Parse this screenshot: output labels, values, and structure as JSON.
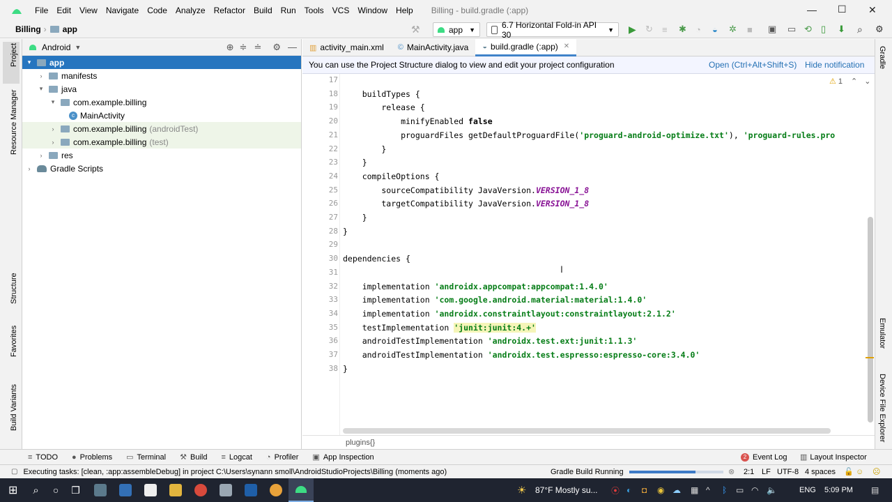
{
  "titlebar": {
    "menu": [
      "File",
      "Edit",
      "View",
      "Navigate",
      "Code",
      "Analyze",
      "Refactor",
      "Build",
      "Run",
      "Tools",
      "VCS",
      "Window",
      "Help"
    ],
    "title": "Billing - build.gradle (:app)"
  },
  "navbar": {
    "project": "Billing",
    "module": "app",
    "run_config": "app",
    "device": "6.7  Horizontal Fold-in API 30"
  },
  "left_strip": [
    "Project",
    "Resource Manager",
    "Structure",
    "Favorites",
    "Build Variants"
  ],
  "right_strip": [
    "Gradle",
    "Emulator",
    "Device File Explorer"
  ],
  "project_panel": {
    "view_mode": "Android",
    "tree": [
      {
        "label": "app",
        "muted": "",
        "depth": 0,
        "arrow": "▾",
        "icon": "folder",
        "selected": true,
        "green": false
      },
      {
        "label": "manifests",
        "muted": "",
        "depth": 1,
        "arrow": "›",
        "icon": "folder",
        "selected": false,
        "green": false
      },
      {
        "label": "java",
        "muted": "",
        "depth": 1,
        "arrow": "▾",
        "icon": "folder",
        "selected": false,
        "green": false
      },
      {
        "label": "com.example.billing",
        "muted": "",
        "depth": 2,
        "arrow": "▾",
        "icon": "folder",
        "selected": false,
        "green": false
      },
      {
        "label": "MainActivity",
        "muted": "",
        "depth": 3,
        "arrow": "",
        "icon": "class",
        "selected": false,
        "green": false
      },
      {
        "label": "com.example.billing",
        "muted": "(androidTest)",
        "depth": 2,
        "arrow": "›",
        "icon": "folder",
        "selected": false,
        "green": true
      },
      {
        "label": "com.example.billing",
        "muted": "(test)",
        "depth": 2,
        "arrow": "›",
        "icon": "folder",
        "selected": false,
        "green": true
      },
      {
        "label": "res",
        "muted": "",
        "depth": 1,
        "arrow": "›",
        "icon": "folder",
        "selected": false,
        "green": false
      },
      {
        "label": "Gradle Scripts",
        "muted": "",
        "depth": 0,
        "arrow": "›",
        "icon": "gradle",
        "selected": false,
        "green": false
      }
    ]
  },
  "tabs": [
    {
      "label": "activity_main.xml",
      "active": false
    },
    {
      "label": "MainActivity.java",
      "active": false
    },
    {
      "label": "build.gradle (:app)",
      "active": true
    }
  ],
  "notice": {
    "text": "You can use the Project Structure dialog to view and edit your project configuration",
    "open_link": "Open (Ctrl+Alt+Shift+S)",
    "hide_link": "Hide notification"
  },
  "editor": {
    "warning_count": "1",
    "lines": [
      {
        "n": "17",
        "parts": []
      },
      {
        "n": "18",
        "parts": [
          [
            "",
            "    buildTypes {"
          ]
        ]
      },
      {
        "n": "19",
        "parts": [
          [
            "",
            "        release {"
          ]
        ]
      },
      {
        "n": "20",
        "parts": [
          [
            "",
            "            minifyEnabled "
          ],
          [
            "kw",
            "false"
          ]
        ]
      },
      {
        "n": "21",
        "parts": [
          [
            "",
            "            proguardFiles getDefaultProguardFile("
          ],
          [
            "str",
            "'proguard-android-optimize.txt'"
          ],
          [
            "",
            "), "
          ],
          [
            "str",
            "'proguard-rules.pro"
          ]
        ]
      },
      {
        "n": "22",
        "parts": [
          [
            "",
            "        }"
          ]
        ]
      },
      {
        "n": "23",
        "parts": [
          [
            "",
            "    }"
          ]
        ]
      },
      {
        "n": "24",
        "parts": [
          [
            "",
            "    compileOptions {"
          ]
        ]
      },
      {
        "n": "25",
        "parts": [
          [
            "",
            "        sourceCompatibility JavaVersion."
          ],
          [
            "it",
            "VERSION_1_8"
          ]
        ]
      },
      {
        "n": "26",
        "parts": [
          [
            "",
            "        targetCompatibility JavaVersion."
          ],
          [
            "it",
            "VERSION_1_8"
          ]
        ]
      },
      {
        "n": "27",
        "parts": [
          [
            "",
            "    }"
          ]
        ]
      },
      {
        "n": "28",
        "parts": [
          [
            "",
            "}"
          ]
        ]
      },
      {
        "n": "29",
        "parts": []
      },
      {
        "n": "30",
        "parts": [
          [
            "",
            "dependencies {"
          ]
        ]
      },
      {
        "n": "31",
        "parts": []
      },
      {
        "n": "32",
        "parts": [
          [
            "",
            "    implementation "
          ],
          [
            "str",
            "'androidx.appcompat:appcompat:1.4.0'"
          ]
        ]
      },
      {
        "n": "33",
        "parts": [
          [
            "",
            "    implementation "
          ],
          [
            "str",
            "'com.google.android.material:material:1.4.0'"
          ]
        ]
      },
      {
        "n": "34",
        "parts": [
          [
            "",
            "    implementation "
          ],
          [
            "str",
            "'androidx.constraintlayout:constraintlayout:2.1.2'"
          ]
        ]
      },
      {
        "n": "35",
        "parts": [
          [
            "",
            "    testImplementation "
          ],
          [
            "str hl",
            "'junit:junit:4.+'"
          ]
        ]
      },
      {
        "n": "36",
        "parts": [
          [
            "",
            "    androidTestImplementation "
          ],
          [
            "str",
            "'androidx.test.ext:junit:1.1.3'"
          ]
        ]
      },
      {
        "n": "37",
        "parts": [
          [
            "",
            "    androidTestImplementation "
          ],
          [
            "str",
            "'androidx.test.espresso:espresso-core:3.4.0'"
          ]
        ]
      },
      {
        "n": "38",
        "parts": [
          [
            "",
            "}"
          ]
        ]
      }
    ]
  },
  "code_breadcrumb": "plugins{}",
  "bottom_tools": {
    "left": [
      "TODO",
      "Problems",
      "Terminal",
      "Build",
      "Logcat",
      "Profiler",
      "App Inspection"
    ],
    "event_log": "Event Log",
    "event_log_count": "2",
    "layout_inspector": "Layout Inspector"
  },
  "status": {
    "message": "Executing tasks: [clean, :app:assembleDebug] in project C:\\Users\\synann smoll\\AndroidStudioProjects\\Billing (moments ago)",
    "task": "Gradle Build Running",
    "position": "2:1",
    "line_sep": "LF",
    "encoding": "UTF-8",
    "indent": "4 spaces"
  },
  "taskbar": {
    "weather": "87°F  Mostly su...",
    "lang": "ENG",
    "time": "5:09 PM"
  }
}
